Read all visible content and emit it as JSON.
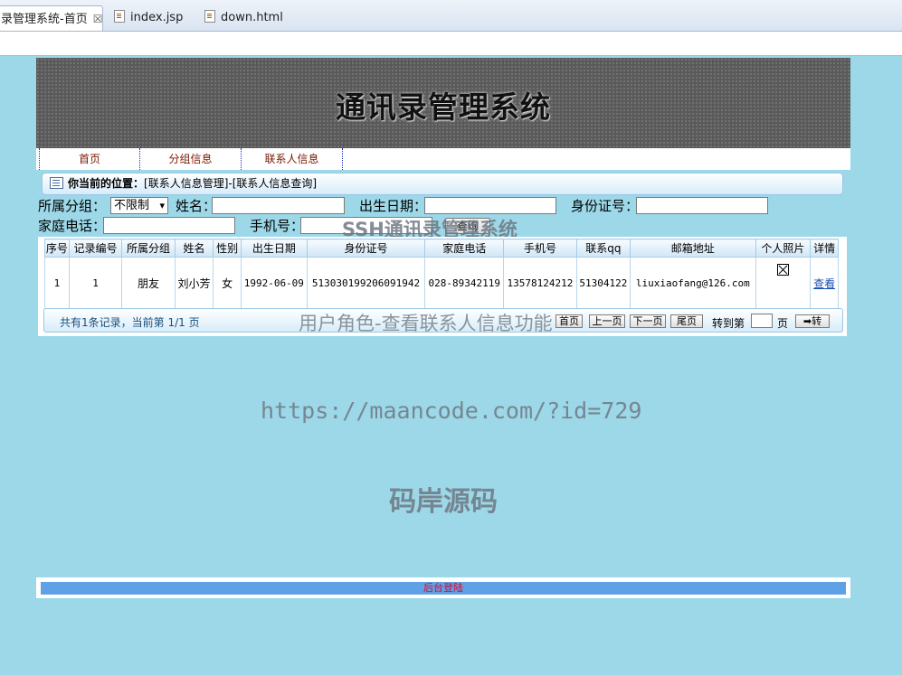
{
  "tabs": [
    {
      "label": "录管理系统-首页",
      "close": "☒"
    },
    {
      "label": "index.jsp"
    },
    {
      "label": "down.html"
    }
  ],
  "banner": {
    "title": "通讯录管理系统"
  },
  "nav": {
    "items": [
      "首页",
      "分组信息",
      "联系人信息"
    ]
  },
  "breadcrumb": {
    "prefix": "你当前的位置：",
    "path": "[联系人信息管理]-[联系人信息查询]"
  },
  "search": {
    "group_label": "所属分组：",
    "group_value": "不限制",
    "name_label": "姓名：",
    "birth_label": "出生日期：",
    "idcard_label": "身份证号：",
    "homephone_label": "家庭电话：",
    "mobile_label": "手机号：",
    "query_button": "查询"
  },
  "watermarks": {
    "title": "SSH通讯录管理系统",
    "subtitle": "用户角色-查看联系人信息功能",
    "url": "https://maancode.com/?id=729",
    "brand": "码岸源码"
  },
  "table": {
    "columns": [
      "序号",
      "记录编号",
      "所属分组",
      "姓名",
      "性别",
      "出生日期",
      "身份证号",
      "家庭电话",
      "手机号",
      "联系qq",
      "邮箱地址",
      "个人照片",
      "详情"
    ],
    "rows": [
      {
        "index": "1",
        "record_no": "1",
        "group": "朋友",
        "name": "刘小芳",
        "gender": "女",
        "birth": "1992-06-09",
        "idcard": "513030199206091942",
        "homephone": "028-89342119",
        "mobile": "13578124212",
        "qq": "51304122",
        "email": "liuxiaofang@126.com",
        "photo": "broken-image-icon",
        "detail": "查看"
      }
    ]
  },
  "pager": {
    "info": "共有1条记录，当前第 1/1 页",
    "first": "首页",
    "prev": "上一页",
    "next": "下一页",
    "last": "尾页",
    "goto_label": "转到第",
    "page_label": "页",
    "go": "➡转"
  },
  "footer": {
    "link": "后台登陆"
  }
}
